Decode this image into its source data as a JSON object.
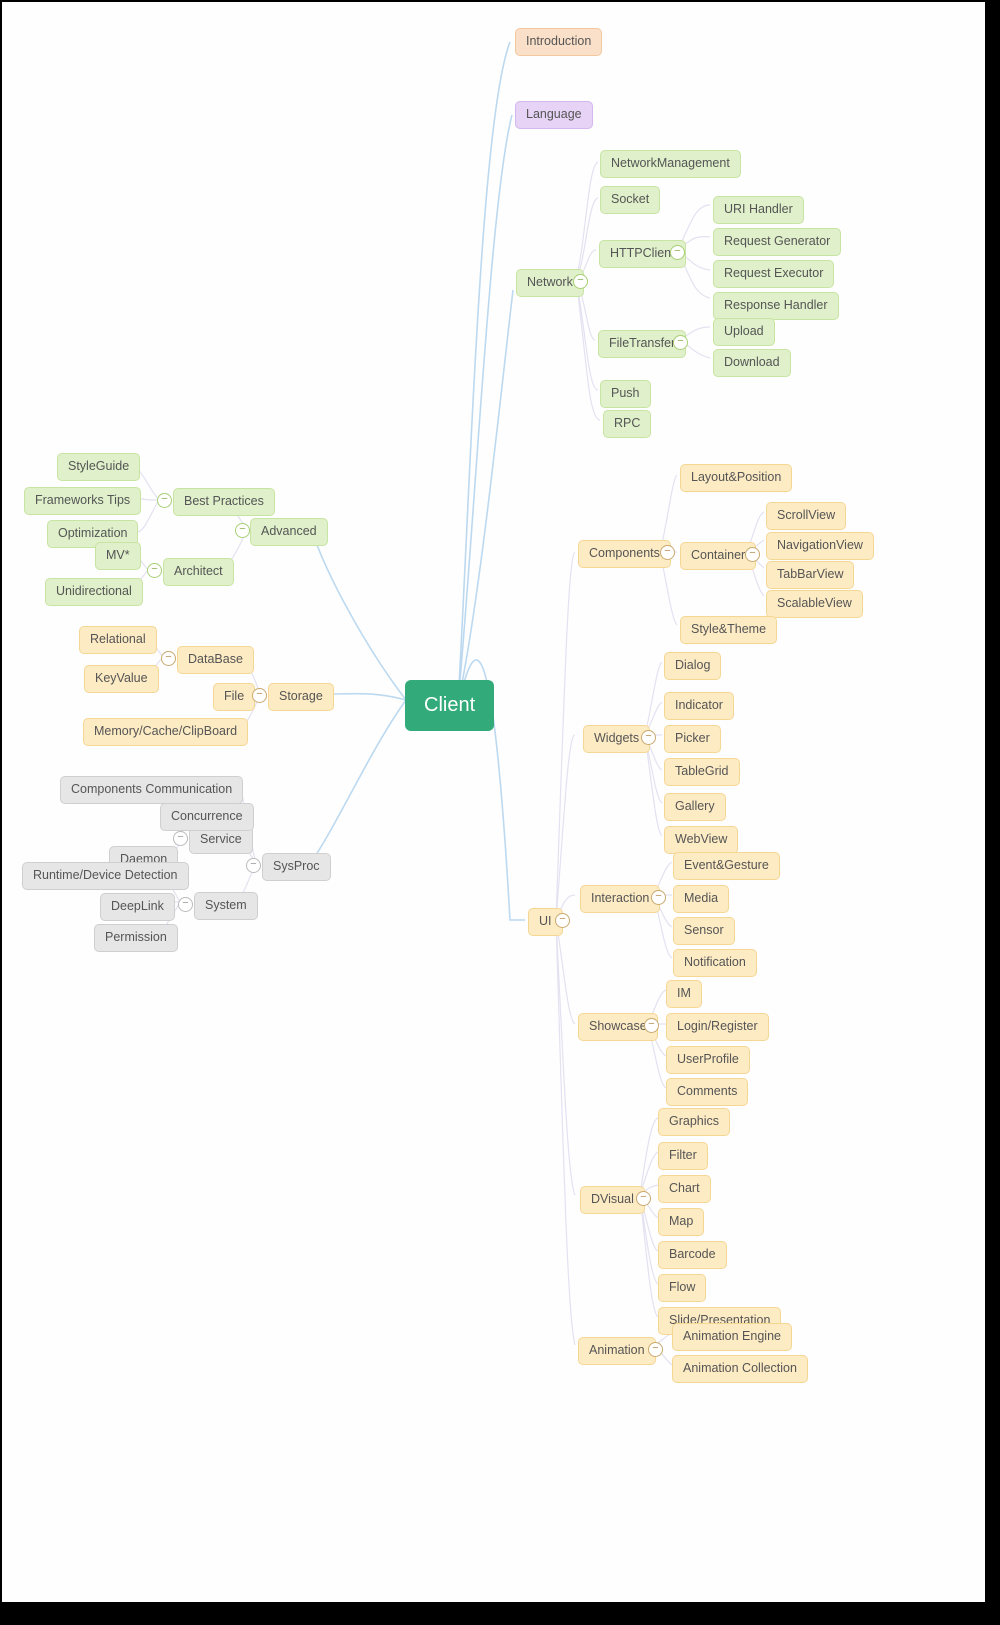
{
  "root": "Client",
  "toggle_glyph": "−",
  "nodes": {
    "introduction": "Introduction",
    "language": "Language",
    "network": "Network",
    "networkmgmt": "NetworkManagement",
    "socket": "Socket",
    "httpclient": "HTTPClient",
    "uri_handler": "URI Handler",
    "req_gen": "Request Generator",
    "req_exec": "Request Executor",
    "resp_handler": "Response Handler",
    "filetransfer": "FileTransfer",
    "upload": "Upload",
    "download": "Download",
    "push": "Push",
    "rpc": "RPC",
    "advanced": "Advanced",
    "best_practices": "Best Practices",
    "styleguide": "StyleGuide",
    "frameworks_tips": "Frameworks Tips",
    "optimization": "Optimization",
    "architect": "Architect",
    "mv": "MV*",
    "unidirectional": "Unidirectional",
    "storage": "Storage",
    "database": "DataBase",
    "relational": "Relational",
    "keyvalue": "KeyValue",
    "file": "File",
    "memcache": "Memory/Cache/ClipBoard",
    "sysproc": "SysProc",
    "compcomm": "Components Communication",
    "service": "Service",
    "concurrence": "Concurrence",
    "daemon": "Daemon",
    "system": "System",
    "runtime": "Runtime/Device Detection",
    "deeplink": "DeepLink",
    "permission": "Permission",
    "ui": "UI",
    "components": "Components",
    "layoutpos": "Layout&Position",
    "container": "Container",
    "scrollview": "ScrollView",
    "navview": "NavigationView",
    "tabbar": "TabBarView",
    "scalable": "ScalableView",
    "styletheme": "Style&Theme",
    "widgets": "Widgets",
    "dialog": "Dialog",
    "indicator": "Indicator",
    "picker": "Picker",
    "tablegrid": "TableGrid",
    "gallery": "Gallery",
    "webview": "WebView",
    "interaction": "Interaction",
    "event": "Event&Gesture",
    "media": "Media",
    "sensor": "Sensor",
    "notification": "Notification",
    "showcase": "Showcase",
    "im": "IM",
    "login": "Login/Register",
    "userprofile": "UserProfile",
    "comments": "Comments",
    "dvisual": "DVisual",
    "graphics": "Graphics",
    "filter": "Filter",
    "chart": "Chart",
    "map": "Map",
    "barcode": "Barcode",
    "flow": "Flow",
    "slide": "Slide/Presentation",
    "animation": "Animation",
    "anim_engine": "Animation Engine",
    "anim_coll": "Animation Collection"
  },
  "colors": {
    "root_bg": "#33aa7a",
    "orange": "#fbe0c9",
    "purple": "#e6d3f5",
    "green": "#dff0ca",
    "yellow": "#fdebc4",
    "gray": "#e6e6e6",
    "link_blue": "#7ab8e6",
    "link_pale": "#e2dff0"
  }
}
